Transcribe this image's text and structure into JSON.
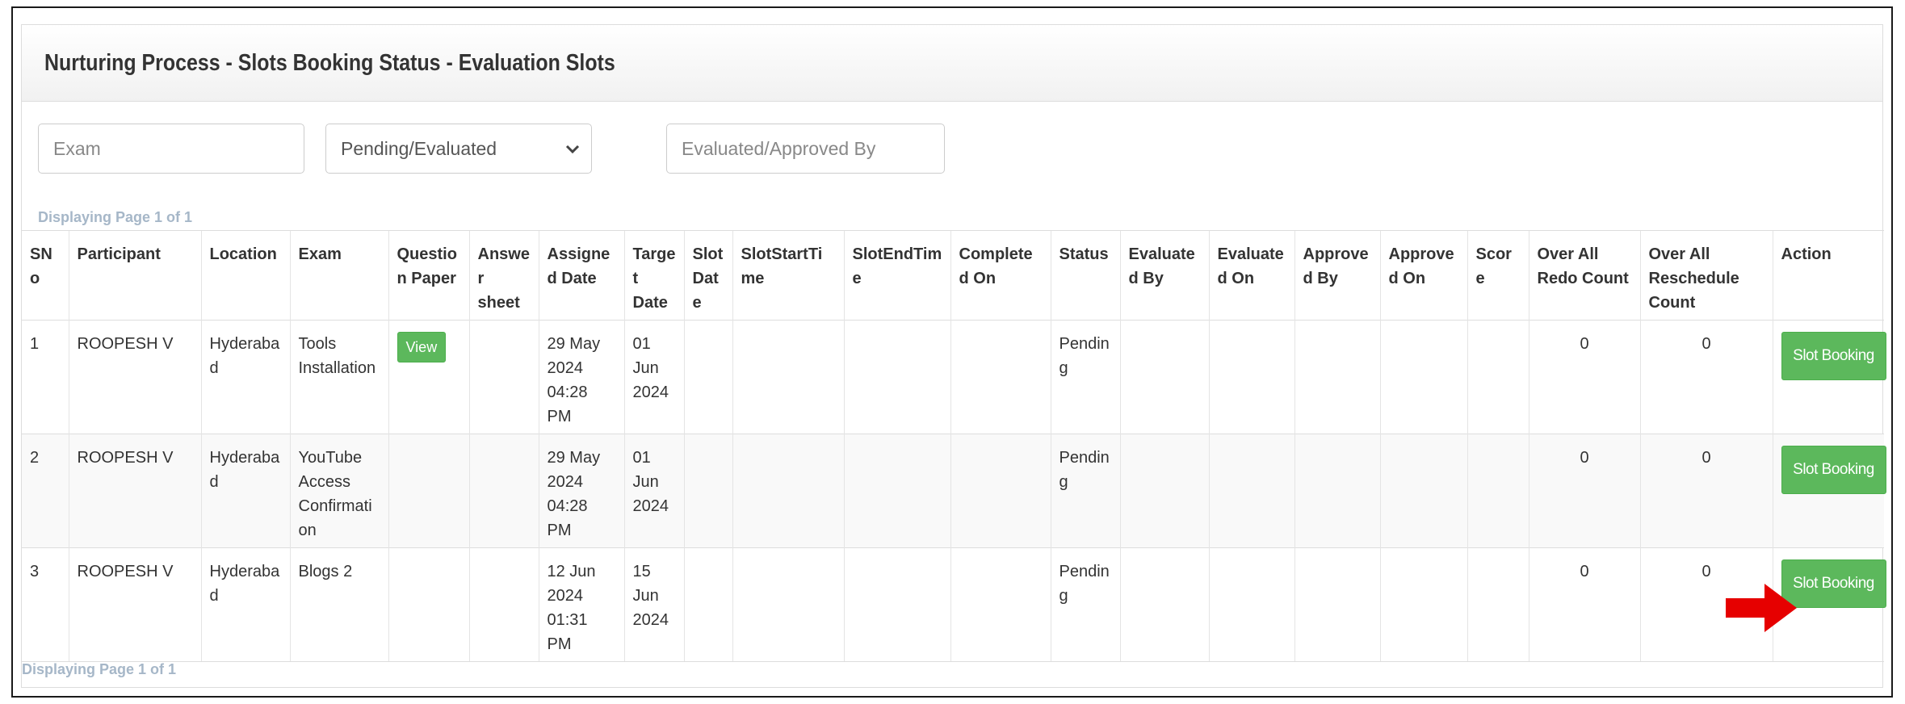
{
  "panel": {
    "title": "Nurturing Process - Slots Booking Status - Evaluation Slots"
  },
  "filters": {
    "exam_placeholder": "Exam",
    "status_selected": "Pending/Evaluated",
    "evaluator_placeholder": "Evaluated/Approved By"
  },
  "pagination": {
    "text": "Displaying Page 1 of 1"
  },
  "table": {
    "columns": {
      "sno": "SNo",
      "participant": "Participant",
      "location": "Location",
      "exam": "Exam",
      "question_paper": "Question Paper",
      "answer_sheet": "Answer sheet",
      "assigned_date": "Assigned Date",
      "target_date": "Target Date",
      "slot_date": "Slot Date",
      "slot_start_time": "SlotStartTime",
      "slot_end_time": "SlotEndTime",
      "completed_on": "Completed On",
      "status": "Status",
      "evaluated_by": "Evaluated By",
      "evaluated_on": "Evaluated On",
      "approved_by": "Approved By",
      "approved_on": "Approved On",
      "score": "Score",
      "redo_count": "Over All Redo Count",
      "reschedule_count": "Over All Reschedule Count",
      "action": "Action"
    },
    "rows": [
      {
        "sno": "1",
        "participant": "ROOPESH V",
        "location": "Hyderabad",
        "exam": "Tools Installation",
        "question_paper_button": "View",
        "assigned_date": "29 May 2024 04:28 PM",
        "target_date": "01 Jun 2024",
        "status": "Pending",
        "redo_count": "0",
        "reschedule_count": "0",
        "action_label": "Slot Booking"
      },
      {
        "sno": "2",
        "participant": "ROOPESH V",
        "location": "Hyderabad",
        "exam": "YouTube Access Confirmation",
        "assigned_date": "29 May 2024 04:28 PM",
        "target_date": "01 Jun 2024",
        "status": "Pending",
        "redo_count": "0",
        "reschedule_count": "0",
        "action_label": "Slot Booking"
      },
      {
        "sno": "3",
        "participant": "ROOPESH V",
        "location": "Hyderabad",
        "exam": "Blogs 2",
        "assigned_date": "12 Jun 2024 01:31 PM",
        "target_date": "15 Jun 2024",
        "status": "Pending",
        "redo_count": "0",
        "reschedule_count": "0",
        "action_label": "Slot Booking"
      }
    ]
  },
  "colors": {
    "button_green": "#5cb85c",
    "pagination_text": "#a6b7c8",
    "annotation_arrow": "#e60000"
  },
  "icons": {
    "select_caret": "chevron-down-icon",
    "annotation": "arrow-right-icon"
  }
}
